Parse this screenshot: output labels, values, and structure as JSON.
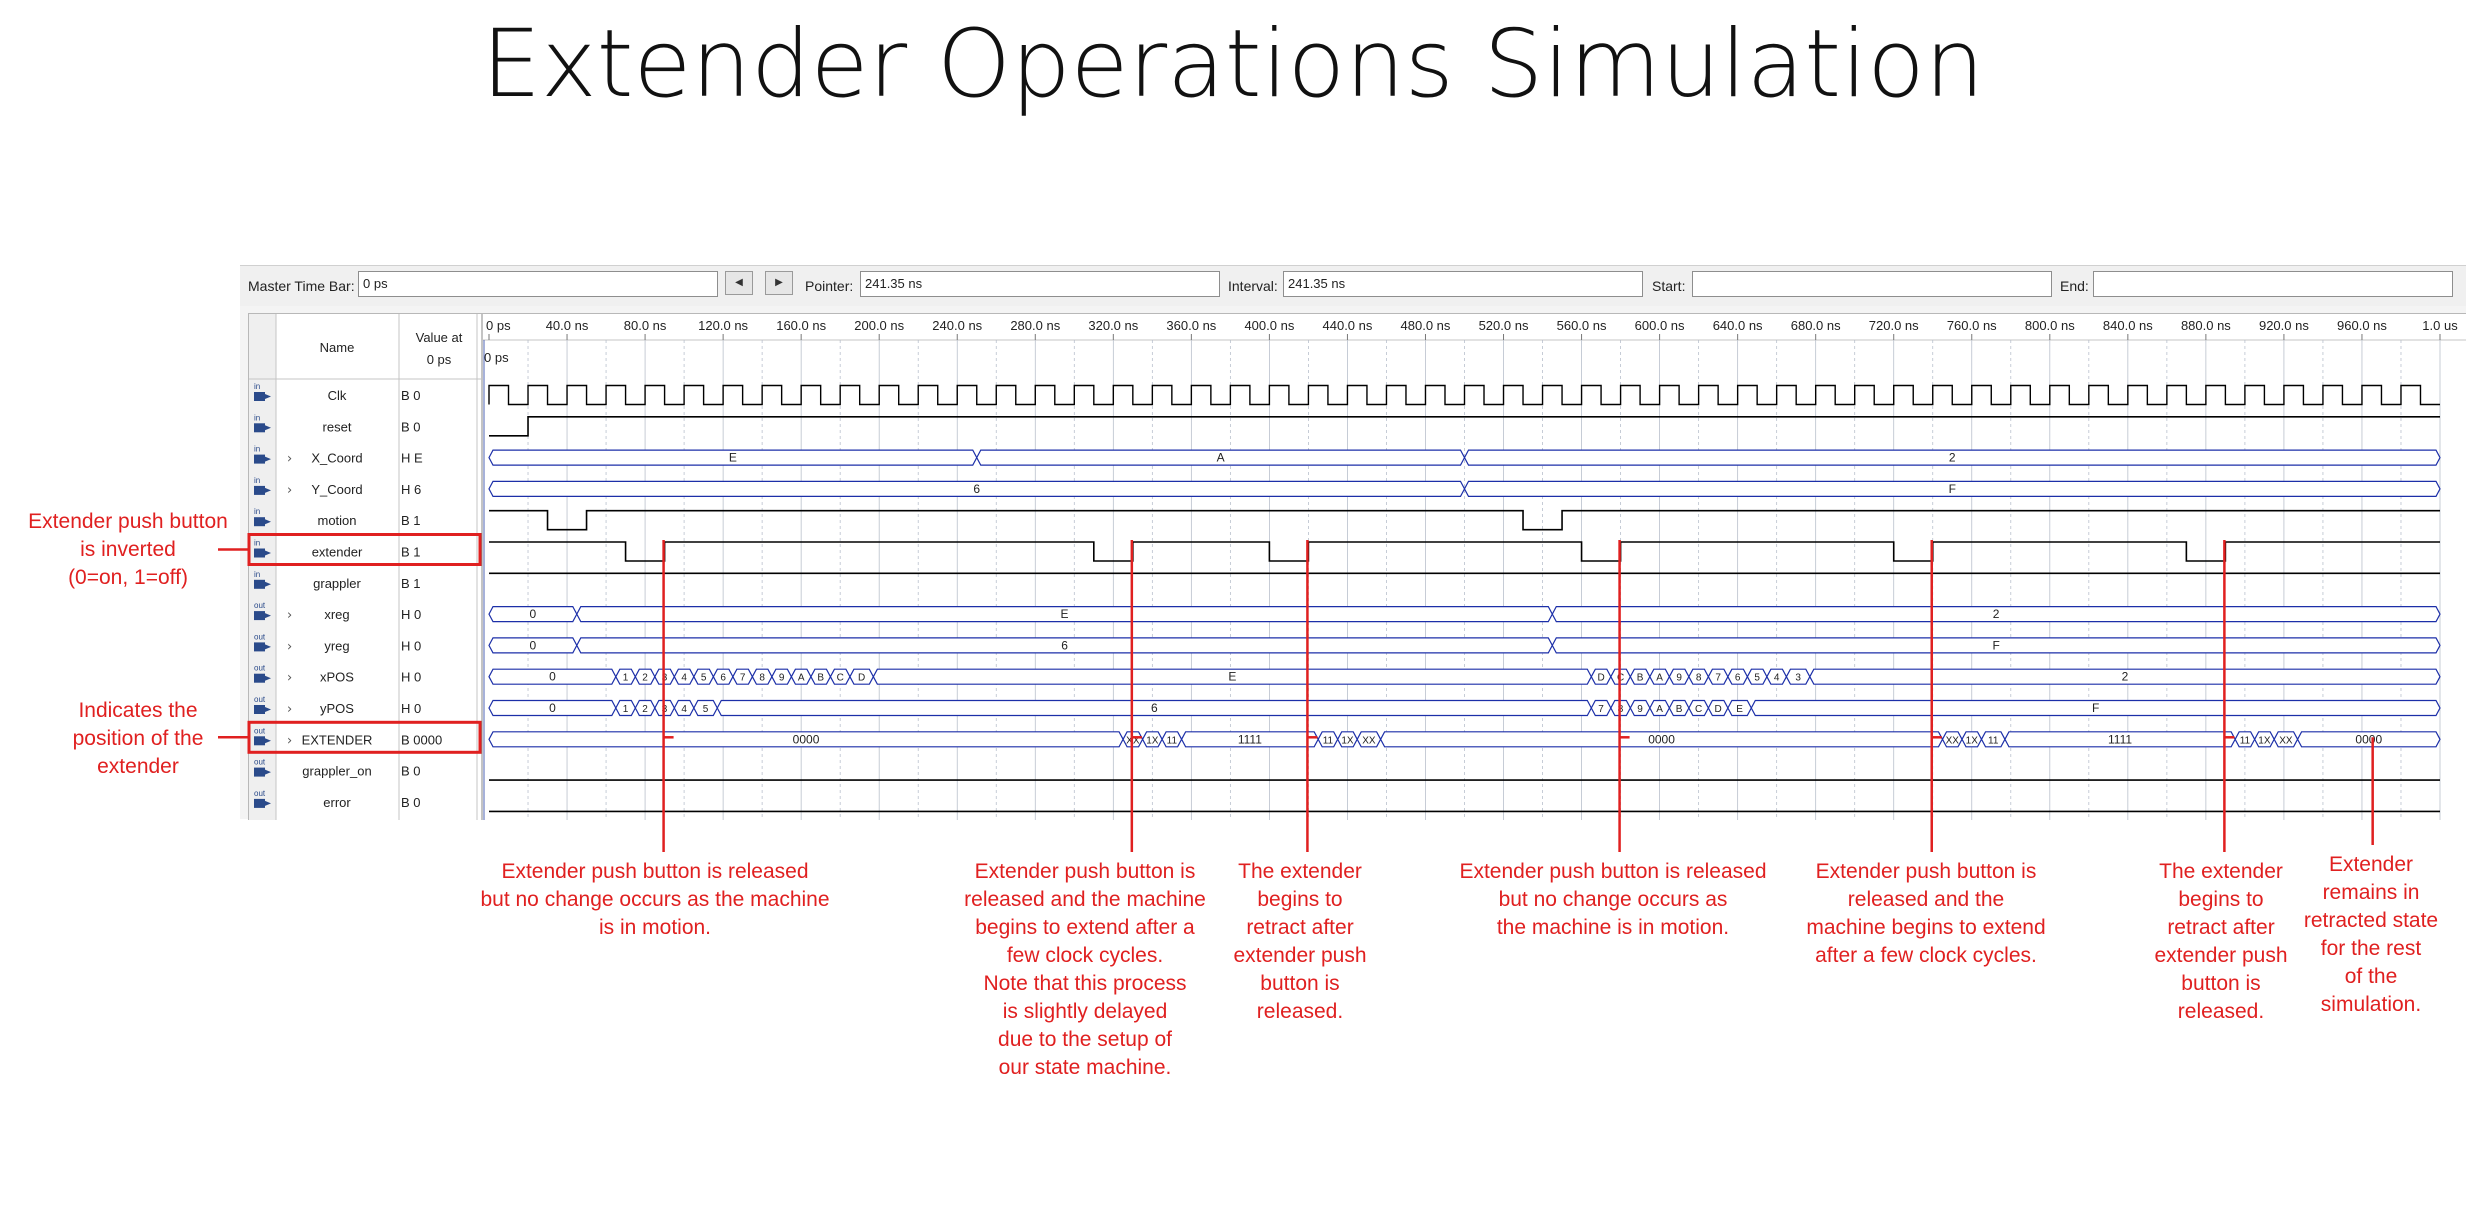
{
  "slide": {
    "title": "Extender Operations Simulation"
  },
  "toolbar": {
    "master_time_bar_label": "Master Time Bar:",
    "master_time_bar_value": "0 ps",
    "pointer_label": "Pointer:",
    "pointer_value": "241.35 ns",
    "interval_label": "Interval:",
    "interval_value": "241.35 ns",
    "start_label": "Start:",
    "start_value": "",
    "end_label": "End:",
    "end_value": "",
    "prev_icon": "triangle-left-icon",
    "next_icon": "triangle-right-icon"
  },
  "table": {
    "name_header": "Name",
    "value_header": "Value at 0 ps",
    "cursor_label": "0 ps",
    "time_ticks": [
      "0 ps",
      "40.0 ns",
      "80.0 ns",
      "120.0 ns",
      "160.0 ns",
      "200.0 ns",
      "240.0 ns",
      "280.0 ns",
      "320.0 ns",
      "360.0 ns",
      "400.0 ns",
      "440.0 ns",
      "480.0 ns",
      "520.0 ns",
      "560.0 ns",
      "600.0 ns",
      "640.0 ns",
      "680.0 ns",
      "720.0 ns",
      "760.0 ns",
      "800.0 ns",
      "840.0 ns",
      "880.0 ns",
      "920.0 ns",
      "960.0 ns",
      "1.0 us"
    ],
    "time_end_ns": 1000,
    "clock_period_ns": 20
  },
  "signals": [
    {
      "name": "Clk",
      "value": "B 0",
      "dir": "in",
      "expandable": false,
      "kind": "clock"
    },
    {
      "name": "reset",
      "value": "B 0",
      "dir": "in",
      "expandable": false,
      "kind": "bit",
      "init": 0,
      "toggles_ns": [
        20
      ]
    },
    {
      "name": "X_Coord",
      "value": "H E",
      "dir": "in",
      "expandable": true,
      "kind": "bus",
      "segments": [
        [
          0,
          250,
          "E"
        ],
        [
          250,
          500,
          "A"
        ],
        [
          500,
          1000,
          "2"
        ]
      ]
    },
    {
      "name": "Y_Coord",
      "value": "H 6",
      "dir": "in",
      "expandable": true,
      "kind": "bus",
      "segments": [
        [
          0,
          500,
          "6"
        ],
        [
          500,
          1000,
          "F"
        ]
      ]
    },
    {
      "name": "motion",
      "value": "B 1",
      "dir": "in",
      "expandable": false,
      "kind": "bit",
      "init": 1,
      "toggles_ns": [
        30,
        50,
        530,
        550
      ]
    },
    {
      "name": "extender",
      "value": "B 1",
      "dir": "in",
      "expandable": false,
      "kind": "bit",
      "init": 1,
      "toggles_ns": [
        70,
        90,
        310,
        330,
        400,
        420,
        560,
        580,
        720,
        740,
        870,
        890
      ]
    },
    {
      "name": "grappler",
      "value": "B 1",
      "dir": "in",
      "expandable": false,
      "kind": "bit",
      "init": 1,
      "toggles_ns": []
    },
    {
      "name": "xreg",
      "value": "H 0",
      "dir": "out",
      "expandable": true,
      "kind": "bus",
      "segments": [
        [
          0,
          45,
          "0"
        ],
        [
          45,
          545,
          "E"
        ],
        [
          545,
          1000,
          "2"
        ]
      ]
    },
    {
      "name": "yreg",
      "value": "H 0",
      "dir": "out",
      "expandable": true,
      "kind": "bus",
      "segments": [
        [
          0,
          45,
          "0"
        ],
        [
          45,
          545,
          "6"
        ],
        [
          545,
          1000,
          "F"
        ]
      ]
    },
    {
      "name": "xPOS",
      "value": "H 0",
      "dir": "out",
      "expandable": true,
      "kind": "bus",
      "segments": [
        [
          0,
          65,
          "0"
        ],
        [
          65,
          75,
          "1"
        ],
        [
          75,
          85,
          "2"
        ],
        [
          85,
          95,
          "3"
        ],
        [
          95,
          105,
          "4"
        ],
        [
          105,
          115,
          "5"
        ],
        [
          115,
          125,
          "6"
        ],
        [
          125,
          135,
          "7"
        ],
        [
          135,
          145,
          "8"
        ],
        [
          145,
          155,
          "9"
        ],
        [
          155,
          165,
          "A"
        ],
        [
          165,
          175,
          "B"
        ],
        [
          175,
          185,
          "C"
        ],
        [
          185,
          197,
          "D"
        ],
        [
          197,
          565,
          "E"
        ],
        [
          565,
          575,
          "D"
        ],
        [
          575,
          585,
          "C"
        ],
        [
          585,
          595,
          "B"
        ],
        [
          595,
          605,
          "A"
        ],
        [
          605,
          615,
          "9"
        ],
        [
          615,
          625,
          "8"
        ],
        [
          625,
          635,
          "7"
        ],
        [
          635,
          645,
          "6"
        ],
        [
          645,
          655,
          "5"
        ],
        [
          655,
          665,
          "4"
        ],
        [
          665,
          677,
          "3"
        ],
        [
          677,
          1000,
          "2"
        ]
      ]
    },
    {
      "name": "yPOS",
      "value": "H 0",
      "dir": "out",
      "expandable": true,
      "kind": "bus",
      "segments": [
        [
          0,
          65,
          "0"
        ],
        [
          65,
          75,
          "1"
        ],
        [
          75,
          85,
          "2"
        ],
        [
          85,
          95,
          "3"
        ],
        [
          95,
          105,
          "4"
        ],
        [
          105,
          117,
          "5"
        ],
        [
          117,
          565,
          "6"
        ],
        [
          565,
          575,
          "7"
        ],
        [
          575,
          585,
          "8"
        ],
        [
          585,
          595,
          "9"
        ],
        [
          595,
          605,
          "A"
        ],
        [
          605,
          615,
          "B"
        ],
        [
          615,
          625,
          "C"
        ],
        [
          625,
          635,
          "D"
        ],
        [
          635,
          647,
          "E"
        ],
        [
          647,
          1000,
          "F"
        ]
      ]
    },
    {
      "name": "EXTENDER",
      "value": "B 0000",
      "dir": "out",
      "expandable": true,
      "kind": "bus",
      "segments": [
        [
          0,
          325,
          "0000"
        ],
        [
          325,
          335,
          "XX"
        ],
        [
          335,
          345,
          "1X"
        ],
        [
          345,
          355,
          "11"
        ],
        [
          355,
          425,
          "1111"
        ],
        [
          425,
          435,
          "11"
        ],
        [
          435,
          445,
          "1X"
        ],
        [
          445,
          457,
          "XX"
        ],
        [
          457,
          745,
          "0000"
        ],
        [
          745,
          755,
          "XX"
        ],
        [
          755,
          765,
          "1X"
        ],
        [
          765,
          777,
          "11"
        ],
        [
          777,
          895,
          "1111"
        ],
        [
          895,
          905,
          "11"
        ],
        [
          905,
          915,
          "1X"
        ],
        [
          915,
          927,
          "XX"
        ],
        [
          927,
          1000,
          "0000"
        ]
      ]
    },
    {
      "name": "grappler_on",
      "value": "B 0",
      "dir": "out",
      "expandable": false,
      "kind": "bit",
      "init": 0,
      "toggles_ns": []
    },
    {
      "name": "error",
      "value": "B 0",
      "dir": "out",
      "expandable": false,
      "kind": "bit",
      "init": 0,
      "toggles_ns": []
    }
  ],
  "annotations": [
    {
      "text": "Extender push button\nis inverted\n(0=on, 1=off)"
    },
    {
      "text": "Indicates the\nposition of the\nextender"
    },
    {
      "text": "Extender push button is released\nbut no change occurs as the machine\nis in motion."
    },
    {
      "text": "Extender push button is\nreleased and the machine\nbegins to extend after a\nfew clock cycles.\nNote that this process\nis slightly delayed\ndue to the setup of\nour state machine."
    },
    {
      "text": "The extender\nbegins to\nretract after\nextender push\nbutton is\nreleased."
    },
    {
      "text": "Extender push button is released\nbut no change occurs as\nthe machine is in motion."
    },
    {
      "text": "Extender push button is\nreleased and the\nmachine begins to extend\nafter a few clock cycles."
    },
    {
      "text": "The extender\nbegins to\nretract after\nextender push\nbutton is\nreleased."
    },
    {
      "text": "Extender\nremains in\nretracted state\nfor the rest\nof the\nsimulation."
    }
  ],
  "colors": {
    "annotation": "#e02020",
    "bus": "#1c2fa8",
    "bit": "#000000",
    "grid": "#b9c0cc"
  }
}
